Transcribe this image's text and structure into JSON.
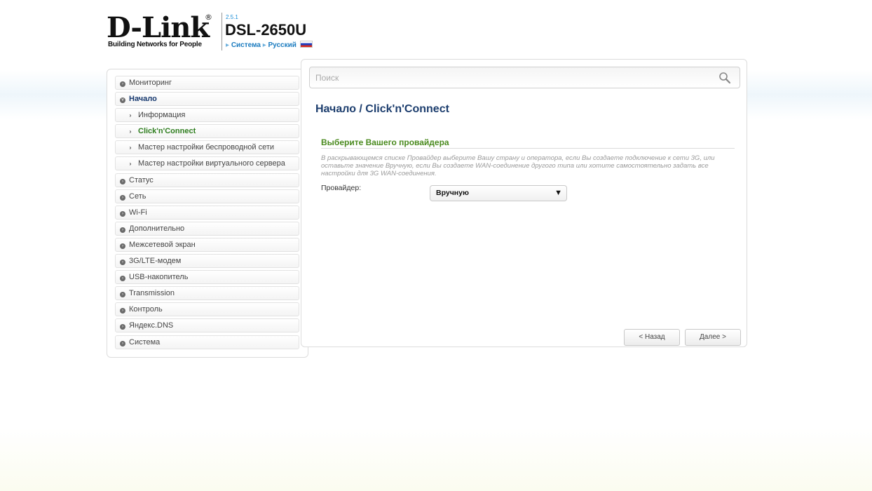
{
  "header": {
    "logo_text": "D-Link",
    "logo_reg": "®",
    "logo_tagline": "Building Networks for People",
    "firmware_version": "2.5.1",
    "model": "DSL-2650U",
    "crumb_system": "Система",
    "crumb_language": "Русский"
  },
  "search": {
    "placeholder": "Поиск"
  },
  "sidebar": {
    "items": [
      {
        "label": "Мониторинг"
      },
      {
        "label": "Начало"
      },
      {
        "label": "Информация"
      },
      {
        "label": "Click'n'Connect"
      },
      {
        "label": "Мастер настройки беспроводной сети"
      },
      {
        "label": "Мастер настройки виртуального сервера"
      },
      {
        "label": "Статус"
      },
      {
        "label": "Сеть"
      },
      {
        "label": "Wi-Fi"
      },
      {
        "label": "Дополнительно"
      },
      {
        "label": "Межсетевой экран"
      },
      {
        "label": "3G/LTE-модем"
      },
      {
        "label": "USB-накопитель"
      },
      {
        "label": "Transmission"
      },
      {
        "label": "Контроль"
      },
      {
        "label": "Яндекс.DNS"
      },
      {
        "label": "Система"
      }
    ]
  },
  "main": {
    "page_title": "Начало /  Click'n'Connect",
    "section_title": "Выберите Вашего провайдера",
    "hint": "В раскрывающемся списке Провайдер выберите Вашу страну и оператора, если Вы создаете подключение к сети 3G, или оставьте значение Вручную, если Вы создаете WAN-соединение другого типа или хотите самостоятельно задать все настройки для 3G WAN-соединения.",
    "provider_label": "Провайдер:",
    "provider_value": "Вручную",
    "back_button": "< Назад",
    "next_button": "Далее >"
  },
  "colors": {
    "title_blue": "#1d3e6e",
    "section_green": "#4a8a1e",
    "link_blue": "#1a7bbf"
  }
}
